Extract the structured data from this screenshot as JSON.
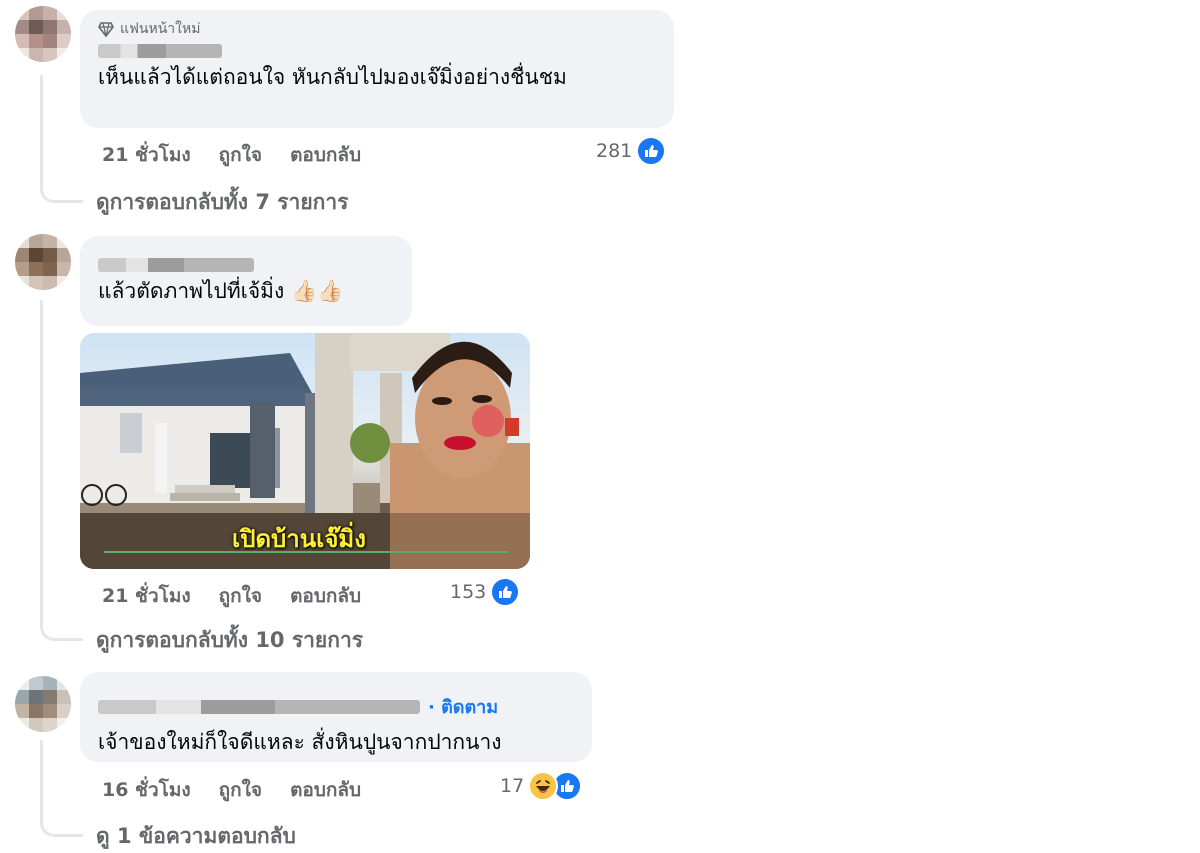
{
  "comments": [
    {
      "badge": "แฟนหน้าใหม่",
      "text": "เห็นแล้วได้แต่ถอนใจ หันกลับไปมองเจ๊มิ่งอย่างชื่นชม",
      "time": "21 ชั่วโมง",
      "like_label": "ถูกใจ",
      "reply_label": "ตอบกลับ",
      "reaction_count": "281",
      "view_replies": "ดูการตอบกลับทั้ง 7 รายการ"
    },
    {
      "text": "แล้วตัดภาพไปที่เจ้มิ่ง 👍🏻👍🏻",
      "photo_caption": "เปิดบ้านเจ๊มิ่ง",
      "time": "21 ชั่วโมง",
      "like_label": "ถูกใจ",
      "reply_label": "ตอบกลับ",
      "reaction_count": "153",
      "view_replies": "ดูการตอบกลับทั้ง 10 รายการ"
    },
    {
      "follow_label": "· ติดตาม",
      "text": "เจ้าของใหม่ก็ใจดีแหละ สั่งหินปูนจากปากนาง",
      "time": "16 ชั่วโมง",
      "like_label": "ถูกใจ",
      "reply_label": "ตอบกลับ",
      "reaction_count": "17",
      "view_replies": "ดู 1 ข้อความตอบกลับ"
    }
  ],
  "icons": {
    "like": "like-icon",
    "haha": "haha-icon",
    "badge": "diamond-badge-icon"
  },
  "colors": {
    "bubble": "#f0f2f5",
    "meta_text": "#65676b",
    "like_blue": "#1877f2"
  }
}
